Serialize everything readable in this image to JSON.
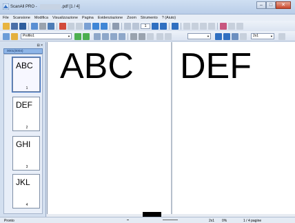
{
  "window": {
    "title_prefix": "ScanAll PRO -",
    "title_suffix": ".pdf [1 / 4]",
    "minimize_glyph": "–",
    "maximize_glyph": "□",
    "close_glyph": "✕"
  },
  "menu": [
    "File",
    "Scansione",
    "Modifica",
    "Visualizzazione",
    "Pagina",
    "Evidenziazione",
    "Zoom",
    "Strumento",
    "? (Aiuto)"
  ],
  "toolbar1": {
    "page_field_value": "1"
  },
  "toolbar2": {
    "profile_combo": "Profilo1",
    "zoom_combo": "2x1"
  },
  "sidebar": {
    "pin_glyph": "⊟ ×",
    "batch_title": "0001(0004)",
    "thumbnails": [
      {
        "text": "ABC",
        "number": "1"
      },
      {
        "text": "DEF",
        "number": "2"
      },
      {
        "text": "GHI",
        "number": "3"
      },
      {
        "text": "JKL",
        "number": "4"
      }
    ]
  },
  "document": {
    "left_page_text": "ABC",
    "right_page_text": "DEF"
  },
  "status": {
    "left": "Pronto",
    "zoom": "2x1",
    "percent": "0%",
    "pages": "1 / 4 pagine"
  }
}
